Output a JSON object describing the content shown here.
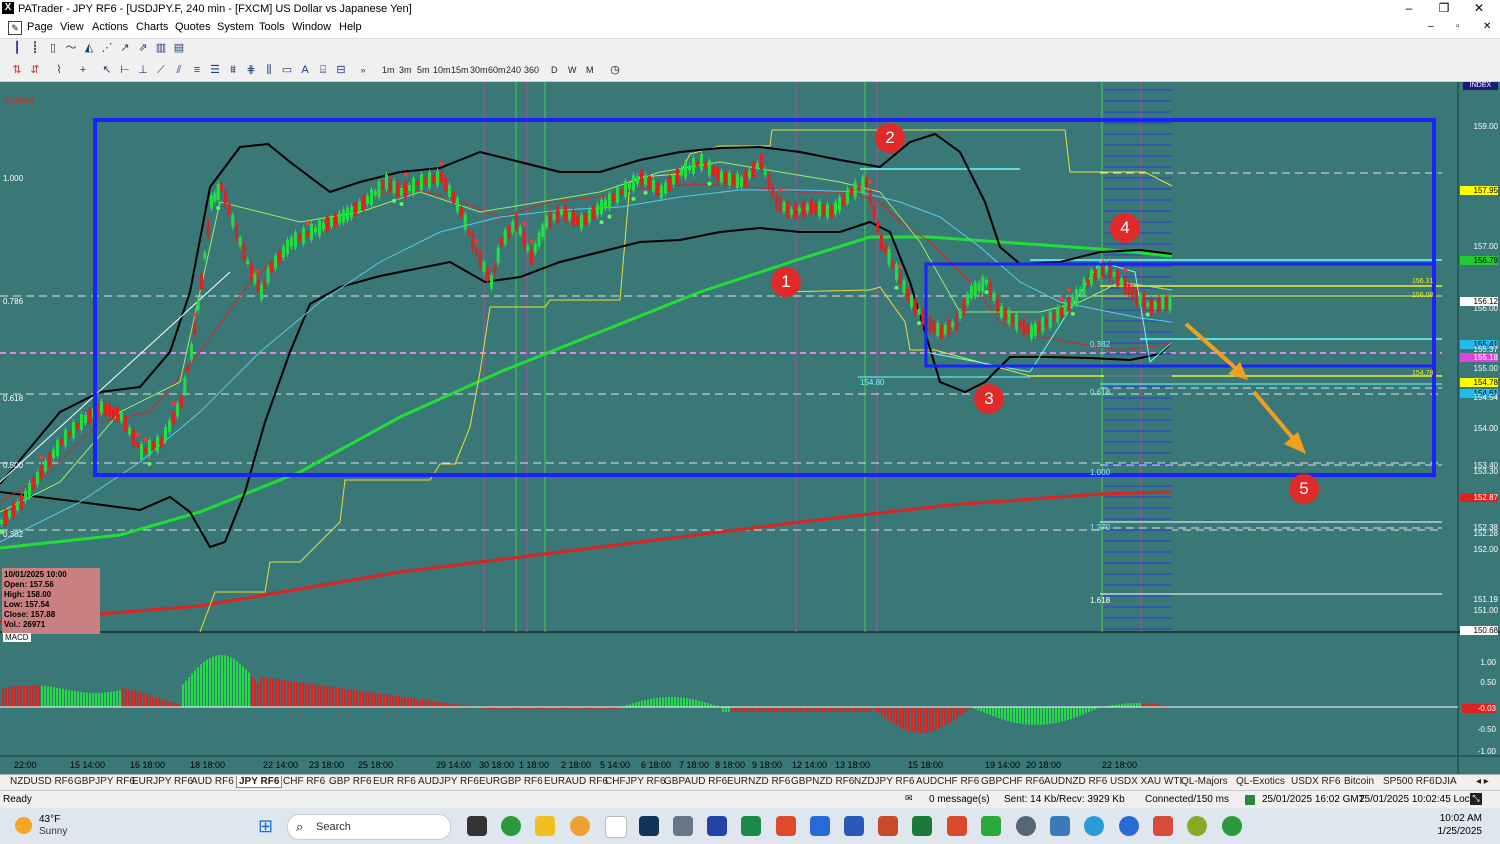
{
  "window": {
    "title": "PATrader - JPY RF6 - [USDJPY.F, 240 min - [FXCM] US Dollar vs Japanese Yen]",
    "minimize": "–",
    "maximize": "❐",
    "close": "✕",
    "inner_minimize": "–",
    "inner_restore": "▫",
    "inner_close": "✕"
  },
  "menu": [
    "Page",
    "View",
    "Actions",
    "Charts",
    "Quotes",
    "System",
    "Tools",
    "Window",
    "Help"
  ],
  "timeframes": [
    "1m",
    "3m",
    "5m",
    "10m",
    "15m",
    "30m",
    "60m",
    "240",
    "360",
    "D",
    "W",
    "M"
  ],
  "chart": {
    "locked": "Locked",
    "index_label": "INDEX",
    "price_axis": [
      "159.00",
      "157.95",
      "157.00",
      "156.79",
      "156.12",
      "156.00",
      "155.41",
      "155.37",
      "155.18",
      "155.00",
      "154.78",
      "154.61",
      "154.54",
      "154.00",
      "153.40",
      "153.30",
      "152.87",
      "152.38",
      "152.28",
      "152.00",
      "151.19",
      "151.00",
      "150.68"
    ],
    "fib_left": [
      "1.000",
      "0.786",
      "0.618",
      "0.500",
      "0.382"
    ],
    "fib_right": [
      "0.382",
      "0.618",
      "1.000",
      "1.270",
      "1.618"
    ],
    "small_labels": [
      "156.31",
      "156.08",
      "154.78",
      "154.80"
    ],
    "annotations": [
      "1",
      "2",
      "3",
      "4",
      "5"
    ],
    "ohlc": {
      "date": "10/01/2025 10:00",
      "open": "Open: 157.56",
      "high": "High: 158.00",
      "low": "Low: 157.54",
      "close": "Close: 157.88",
      "vol": "Vol.: 26971"
    },
    "macd_label": "MACD",
    "macd_axis": [
      "1.00",
      "0.50",
      "-0.03",
      "-0.50",
      "-1.00"
    ],
    "date_labels": [
      "22:00",
      "15 14:00",
      "16 18:00",
      "18 18:00",
      "22 14:00",
      "23 18:00",
      "25 18:00",
      "29 14:00",
      "30 18:00",
      "1 18:00",
      "2 18:00",
      "5 14:00",
      "6 18:00",
      "7 18:00",
      "8 18:00",
      "9 18:00",
      "12 14:00",
      "13 18:00",
      "15 18:00",
      "19 14:00",
      "20 18:00",
      "22 18:00"
    ]
  },
  "tabs": [
    "NZDUSD RF6",
    "GBPJPY RF6",
    "EURJPY RF6",
    "AUD RF6",
    "JPY RF6",
    "CHF RF6",
    "GBP RF6",
    "EUR RF6",
    "AUDJPY RF6",
    "EURGBP RF6",
    "EURAUD RF6",
    "CHFJPY RF6",
    "GBPAUD RF6",
    "EURNZD RF6",
    "GBPNZD RF6",
    "NZDJPY RF6",
    "AUDCHF RF6",
    "GBPCHF RF6",
    "AUDNZD RF6",
    "USDX XAU WTI",
    "QL-Majors",
    "QL-Exotics",
    "USDX RF6",
    "Bitcoin",
    "SP500 RF6",
    "DJIA"
  ],
  "active_tab": "JPY RF6",
  "status": {
    "ready": "Ready",
    "messages": "0 message(s)",
    "traffic": "Sent: 14 Kb/Recv: 3929 Kb",
    "connected": "Connected/150 ms",
    "gmt": "25/01/2025 16:02 GMT",
    "local": "25/01/2025 10:02:45 Local"
  },
  "taskbar": {
    "temp": "43°F",
    "weather": "Sunny",
    "search": "Search",
    "time": "10:02 AM",
    "date": "1/25/2025"
  },
  "colors": {
    "chart_bg": "#3a7878",
    "bull": "#22dd44",
    "bear": "#dd2222",
    "box": "#1a22ff",
    "ma_green": "#22dd33",
    "ma_red": "#dd2222",
    "arrow": "#f0a020"
  }
}
